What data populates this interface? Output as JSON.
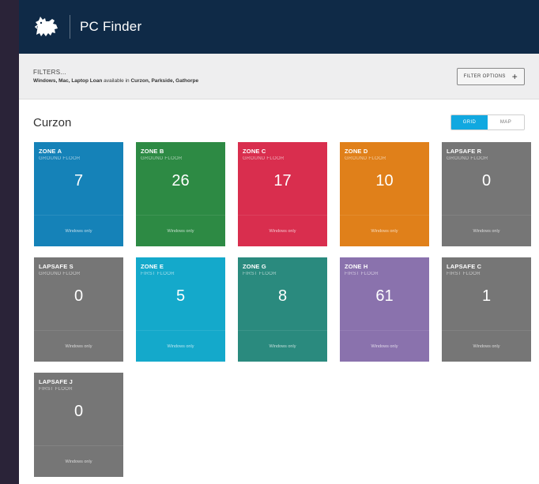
{
  "app": {
    "title": "PC Finder",
    "logo_icon": "lion-crest-icon"
  },
  "filters": {
    "title": "FILTERS...",
    "summary_bold": "Windows, Mac, Laptop Loan",
    "summary_mid": " available in ",
    "summary_locations": "Curzon, Parkside, Gathorpe",
    "button_label": "FILTER OPTIONS",
    "button_icon": "+"
  },
  "location": {
    "title": "Curzon"
  },
  "view_toggle": {
    "grid": "GRID",
    "map": "MAP",
    "active": "grid"
  },
  "colors": {
    "blue": "#1582b8",
    "green": "#2d8a44",
    "red": "#d92e4e",
    "orange": "#e0801a",
    "gray": "#767676",
    "cyan": "#14a9cb",
    "teal": "#2a8a7e",
    "purple": "#8a72ad"
  },
  "tiles": [
    {
      "name": "ZONE A",
      "floor": "GROUND FLOOR",
      "count": "7",
      "note": "Windows only",
      "color": "#1582b8"
    },
    {
      "name": "ZONE B",
      "floor": "GROUND FLOOR",
      "count": "26",
      "note": "Windows only",
      "color": "#2d8a44"
    },
    {
      "name": "ZONE C",
      "floor": "GROUND FLOOR",
      "count": "17",
      "note": "Windows only",
      "color": "#d92e4e"
    },
    {
      "name": "ZONE D",
      "floor": "GROUND FLOOR",
      "count": "10",
      "note": "Windows only",
      "color": "#e0801a"
    },
    {
      "name": "LAPSAFE R",
      "floor": "GROUND FLOOR",
      "count": "0",
      "note": "Windows only",
      "color": "#767676"
    },
    {
      "name": "LAPSAFE S",
      "floor": "GROUND FLOOR",
      "count": "0",
      "note": "Windows only",
      "color": "#767676"
    },
    {
      "name": "ZONE E",
      "floor": "FIRST FLOOR",
      "count": "5",
      "note": "Windows only",
      "color": "#14a9cb"
    },
    {
      "name": "ZONE G",
      "floor": "FIRST FLOOR",
      "count": "8",
      "note": "Windows only",
      "color": "#2a8a7e"
    },
    {
      "name": "ZONE H",
      "floor": "FIRST FLOOR",
      "count": "61",
      "note": "Windows only",
      "color": "#8a72ad"
    },
    {
      "name": "LAPSAFE C",
      "floor": "FIRST FLOOR",
      "count": "1",
      "note": "Windows only",
      "color": "#767676"
    },
    {
      "name": "LAPSAFE J",
      "floor": "FIRST FLOOR",
      "count": "0",
      "note": "Windows only",
      "color": "#767676"
    }
  ]
}
